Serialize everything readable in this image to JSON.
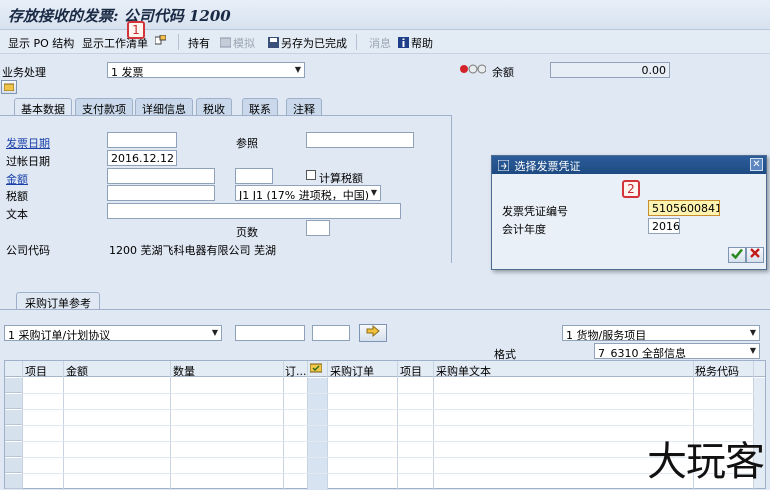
{
  "window": {
    "title": "存放接收的发票: 公司代码 1200"
  },
  "toolbar": {
    "show_po_structure": "显示 PO 结构",
    "show_worklist": "显示工作清单",
    "hold": "持有",
    "simulate": "模拟",
    "save_as_complete": "另存为已完成",
    "messages": "消息",
    "help": "帮助"
  },
  "header": {
    "transaction_label": "业务处理",
    "transaction_value": "1 发票",
    "balance_label": "余额",
    "balance_value": "0.00"
  },
  "tabs": [
    "基本数据",
    "支付款项",
    "详细信息",
    "税收",
    "联系",
    "注释"
  ],
  "basic": {
    "invoice_date_label": "发票日期",
    "invoice_date_value": "",
    "reference_label": "参照",
    "reference_value": "",
    "posting_date_label": "过帐日期",
    "posting_date_value": "2016.12.12",
    "amount_label": "金额",
    "amount_value": "",
    "currency_value": "",
    "calc_tax_label": "计算税额",
    "tax_label": "税额",
    "tax_value": "",
    "tax_code_value": "J1 J1 (17% 进项税，中国)",
    "text_label": "文本",
    "text_value": "",
    "page_label": "页数",
    "page_value": "",
    "company_code_label": "公司代码",
    "company_code_value": "1200 芜湖飞科电器有限公司 芜湖"
  },
  "dialog": {
    "title": "选择发票凭证",
    "doc_number_label": "发票凭证编号",
    "doc_number_value": "5105600841",
    "fiscal_year_label": "会计年度",
    "fiscal_year_value": "2016"
  },
  "annotations": {
    "badge1": "1",
    "badge2": "2"
  },
  "po_section": {
    "tab_label": "采购订单参考",
    "ref_type_value": "1 采购订单/计划协议",
    "po_input_value": "",
    "item_input_value": "",
    "item_type_value": "1 货物/服务项目",
    "layout_label": "格式",
    "layout_value": "7_6310 全部信息"
  },
  "grid": {
    "columns": [
      "项目",
      "金额",
      "数量",
      "订...",
      "采购订单",
      "项目",
      "采购单文本",
      "税务代码"
    ]
  },
  "watermark": "大玩客",
  "colors": {
    "titlebar_bg": "#dfe8f3",
    "dialog_header": "#2c5d9a",
    "highlight_field": "#fff3b0",
    "badge_border": "#d3343a"
  }
}
